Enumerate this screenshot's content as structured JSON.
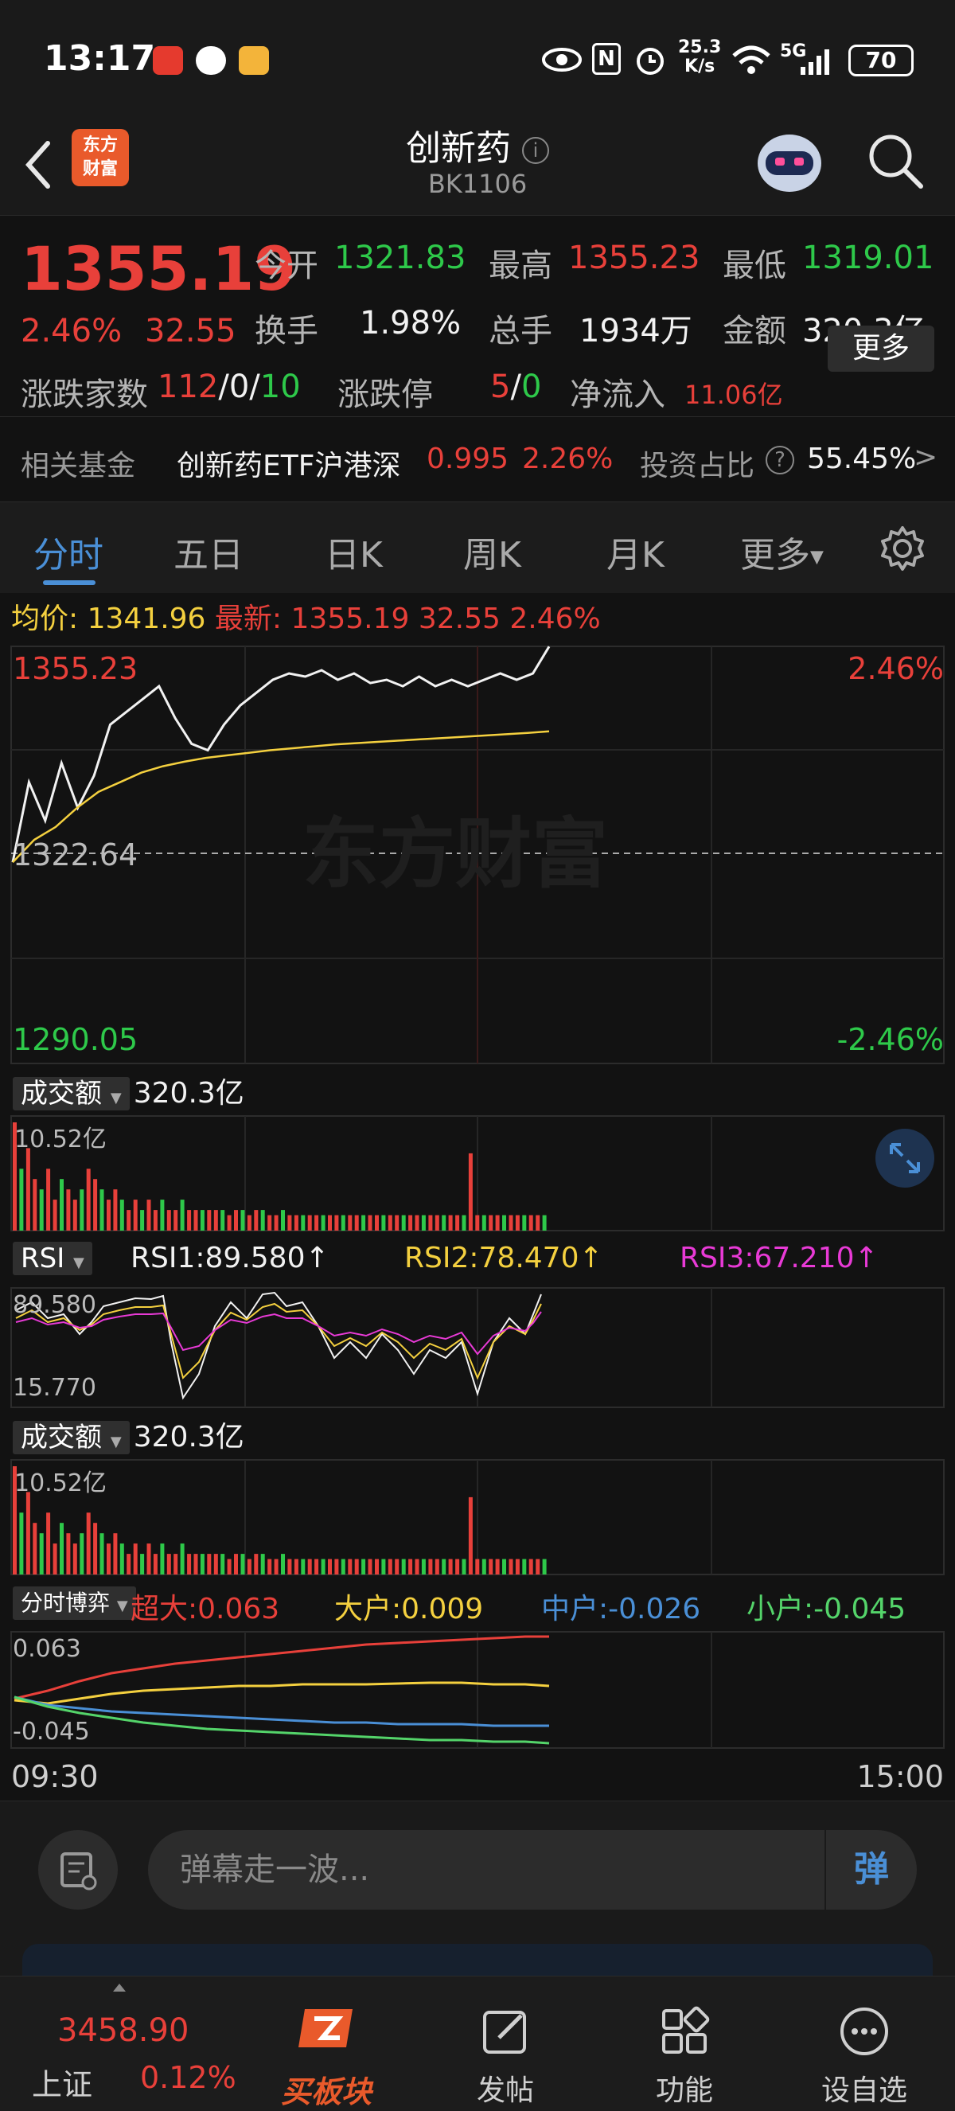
{
  "status_bar": {
    "time": "13:17",
    "net_speed": "25.3",
    "net_unit": "K/s",
    "network": "5G",
    "battery": "70"
  },
  "header": {
    "title": "创新药",
    "code": "BK1106",
    "logo_text": "东方财富"
  },
  "quote": {
    "price": "1355.19",
    "change_pct": "2.46%",
    "change": "32.55",
    "open_label": "今开",
    "open": "1321.83",
    "high_label": "最高",
    "high": "1355.23",
    "low_label": "最低",
    "low": "1319.01",
    "turnover_label": "换手",
    "turnover": "1.98%",
    "volume_label": "总手",
    "volume": "1934万",
    "amount_label": "金额",
    "amount": "320.3亿",
    "updown_label": "涨跌家数",
    "up_count": "112",
    "flat_count": "0",
    "down_count": "10",
    "limit_label": "涨跌停",
    "limit_up": "5",
    "limit_down": "0",
    "inflow_label": "净流入",
    "inflow": "11.06亿",
    "more_label": "更多"
  },
  "fund": {
    "label": "相关基金",
    "name": "创新药ETF沪港深",
    "price": "0.995",
    "pct": "2.26%",
    "ratio_label": "投资占比",
    "ratio": "55.45%"
  },
  "tabs": [
    "分时",
    "五日",
    "日K",
    "周K",
    "月K",
    "更多"
  ],
  "chart_info": {
    "avg_label": "均价:",
    "avg": "1341.96",
    "latest_label": "最新:",
    "latest": "1355.19",
    "change": "32.55",
    "pct": "2.46%"
  },
  "chart_data": [
    {
      "type": "line",
      "name": "intraday",
      "y_top": "1355.23",
      "y_mid": "1322.64",
      "y_bottom": "1290.05",
      "pct_top": "2.46%",
      "pct_bottom": "-2.46%",
      "x_start": "09:30",
      "x_end": "15:00",
      "ylim": [
        1290.05,
        1355.23
      ],
      "series": [
        {
          "values": [
            1321.5,
            1334,
            1328,
            1337,
            1330,
            1335,
            1343,
            1345,
            1347,
            1349,
            1344,
            1340,
            1339,
            1343,
            1346,
            1348,
            1350,
            1351,
            1350.5,
            1351.5,
            1350,
            1351,
            1349.5,
            1350,
            1349,
            1350.5,
            1349,
            1350,
            1349,
            1350,
            1351,
            1350,
            1351,
            1355.2
          ]
        },
        {
          "values": [
            1321.5,
            1325,
            1327,
            1330,
            1332.5,
            1334,
            1335.5,
            1336.5,
            1337.2,
            1337.8,
            1338.2,
            1338.6,
            1339,
            1339.3,
            1339.6,
            1339.9,
            1340.1,
            1340.3,
            1340.5,
            1340.7,
            1340.9,
            1341.1,
            1341.3,
            1341.5,
            1341.7,
            1341.96
          ]
        }
      ]
    },
    {
      "type": "bar",
      "name": "amount",
      "label": "成交额",
      "total": "320.3亿",
      "max_label": "10.52亿",
      "values": [
        10.5,
        6,
        8,
        5,
        4,
        6,
        3,
        5,
        4,
        3,
        4,
        6,
        5,
        4,
        3,
        4,
        3,
        2,
        3,
        2,
        3,
        2,
        3,
        2,
        2,
        3,
        2,
        2,
        2,
        2,
        2,
        2,
        1.5,
        2,
        2,
        1.5,
        2,
        2,
        1.5,
        1.5,
        2,
        1.5,
        1.5,
        1.5,
        1.5,
        1.5,
        1.5,
        1.5,
        1.5,
        1.5,
        1.5,
        1.5,
        1.5,
        1.5,
        1.5,
        1.5,
        1.5,
        1.5,
        1.5,
        1.5,
        1.5,
        1.5,
        1.5,
        1.5,
        1.5,
        1.5,
        1.5,
        1.5,
        7.5,
        1.5,
        1.5,
        1.5,
        1.5,
        1.5,
        1.5,
        1.5,
        1.5,
        1.5,
        1.5,
        1.5
      ]
    },
    {
      "type": "line",
      "name": "rsi",
      "label": "RSI",
      "rsi1": "RSI1:89.580↑",
      "rsi2": "RSI2:78.470↑",
      "rsi3": "RSI3:67.210↑",
      "top": "89.580",
      "bottom": "15.770"
    },
    {
      "type": "bar",
      "name": "amount2",
      "label": "成交额",
      "total": "320.3亿",
      "max_label": "10.52亿"
    },
    {
      "type": "line",
      "name": "capital_game",
      "label": "分时博弈",
      "super": "超大:0.063",
      "large": "大户:0.009",
      "mid": "中户:-0.026",
      "small": "小户:-0.045",
      "top": "0.063",
      "bottom": "-0.045"
    }
  ],
  "comment": {
    "placeholder": "弹幕走一波...",
    "send_label": "弹"
  },
  "bottom_nav": {
    "index_value": "3458.90",
    "index_name": "上证",
    "index_pct": "0.12%",
    "items": [
      "买板块",
      "发帖",
      "功能",
      "设自选"
    ]
  }
}
